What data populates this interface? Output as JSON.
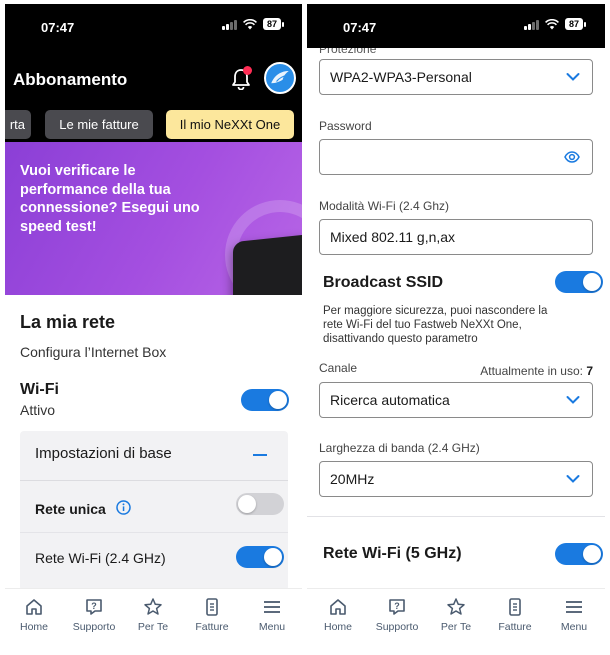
{
  "left": {
    "status": {
      "time": "07:47",
      "battery": "87"
    },
    "header": {
      "title": "Abbonamento"
    },
    "tabs": [
      {
        "label": "rta"
      },
      {
        "label": "Le mie fatture"
      },
      {
        "label": "Il mio NeXXt One",
        "active": true
      }
    ],
    "promo": {
      "text": "Vuoi verificare le performance della tua connessione? Esegui uno speed test!"
    },
    "network": {
      "title": "La mia rete",
      "subtitle": "Configura l’Internet Box",
      "wifi_label": "Wi-Fi",
      "wifi_status": "Attivo",
      "wifi_on": true
    },
    "settings_panel": {
      "title": "Impostazioni di base",
      "rete_unica_label": "Rete unica",
      "rete_unica_on": false,
      "rete_24_label": "Rete Wi-Fi (2.4 GHz)",
      "rete_24_on": true
    }
  },
  "right": {
    "status": {
      "time": "07:47",
      "battery": "87"
    },
    "protezione_cut_label": "Protezione",
    "protezione_value": "WPA2-WPA3-Personal",
    "password_label": "Password",
    "password_value": "",
    "mode_label": "Modalità Wi-Fi (2.4 Ghz)",
    "mode_value": "Mixed 802.11 g,n,ax",
    "broadcast_label": "Broadcast SSID",
    "broadcast_on": true,
    "broadcast_desc": "Per maggiore sicurezza, puoi nascondere la rete Wi-Fi del tuo Fastweb NeXXt One, disattivando questo parametro",
    "channel_label": "Canale",
    "channel_in_use_label": "Attualmente in uso:",
    "channel_in_use_value": "7",
    "channel_value": "Ricerca automatica",
    "bandwidth_label": "Larghezza di banda (2.4 GHz)",
    "bandwidth_value": "20MHz",
    "rete5_label": "Rete Wi-Fi (5 GHz)",
    "rete5_on": true
  },
  "bottom_nav": [
    {
      "label": "Home",
      "icon": "home-icon"
    },
    {
      "label": "Supporto",
      "icon": "support-icon"
    },
    {
      "label": "Per Te",
      "icon": "star-icon"
    },
    {
      "label": "Fatture",
      "icon": "invoice-icon"
    },
    {
      "label": "Menu",
      "icon": "menu-icon"
    }
  ],
  "colors": {
    "accent": "#1a7ae0",
    "promo": "#a44fe0",
    "active_tab": "#fce79c"
  }
}
